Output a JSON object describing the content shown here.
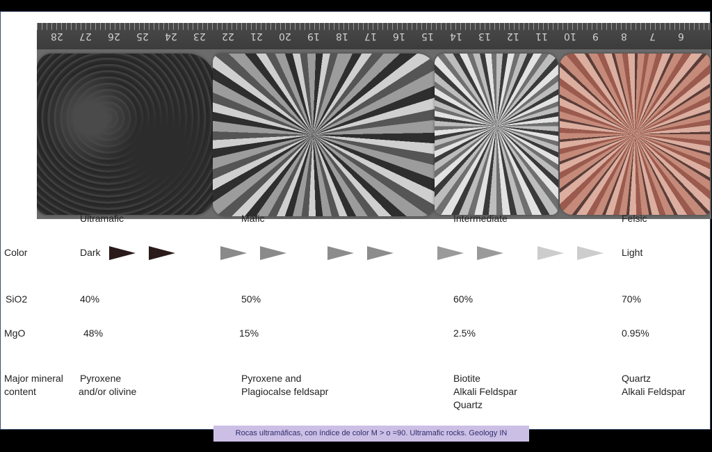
{
  "ruler_numbers": [
    "28",
    "27",
    "26",
    "25",
    "24",
    "23",
    "22",
    "21",
    "20",
    "19",
    "18",
    "17",
    "16",
    "15",
    "14",
    "13",
    "12",
    "11",
    "10",
    "9",
    "8",
    "7",
    "6"
  ],
  "headers": {
    "ultramafic": "Ultramafic",
    "mafic": "Mafic",
    "intermediate": "Intermediate",
    "felsic": "Felsic"
  },
  "rows": {
    "color": {
      "label": "Color",
      "dark": "Dark",
      "light": "Light"
    },
    "sio2": {
      "label": "SiO2",
      "values": [
        "40%",
        "50%",
        "60%",
        "70%"
      ]
    },
    "mgo": {
      "label": "MgO",
      "values": [
        "48%",
        "15%",
        "2.5%",
        "0.95%"
      ]
    },
    "minerals": {
      "label_line1": "Major mineral",
      "label_line2": "content",
      "ultramafic": [
        "Pyroxene",
        "and/or olivine"
      ],
      "mafic": [
        "Pyroxene and",
        "Plagiocalse feldsapr"
      ],
      "intermediate": [
        "Biotite",
        "Alkali Feldspar",
        "Quartz"
      ],
      "felsic": [
        "Quartz",
        "Alkali Feldspar"
      ]
    }
  },
  "arrow_colors": [
    "#2a1a1a",
    "#2a1a1a",
    "#8a8a8a",
    "#8a8a8a",
    "#8c8c8c",
    "#8c8c8c",
    "#9a9a9a",
    "#9a9a9a",
    "#cdcdcd",
    "#cdcdcd"
  ],
  "caption": "Rocas ultramáficas, con índice de color M > o =90. Ultramafic rocks. Geology IN"
}
